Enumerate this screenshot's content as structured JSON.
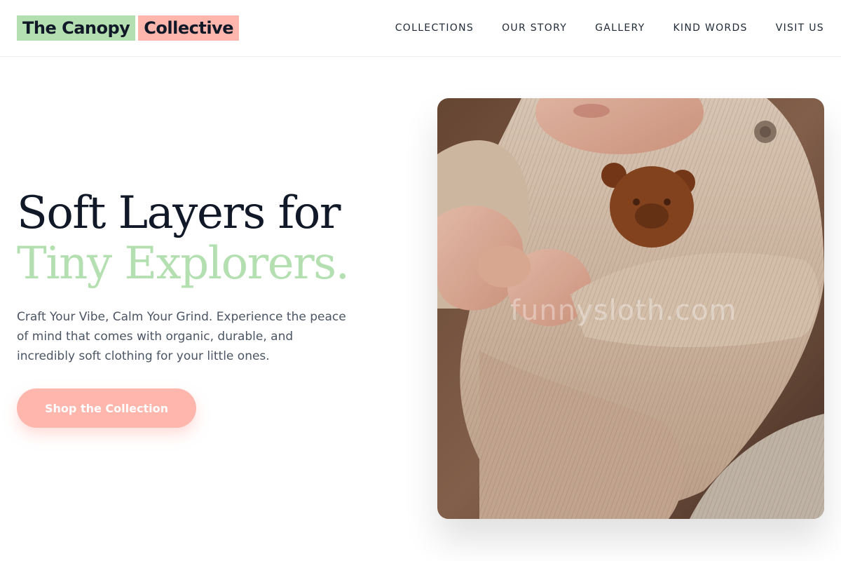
{
  "header": {
    "logo": {
      "part1": "The Canopy",
      "part2": "Collective"
    },
    "nav": [
      {
        "label": "COLLECTIONS"
      },
      {
        "label": "OUR STORY"
      },
      {
        "label": "GALLERY"
      },
      {
        "label": "KIND WORDS"
      },
      {
        "label": "VISIT US"
      }
    ]
  },
  "hero": {
    "title_line1": "Soft Layers for",
    "title_line2": "Tiny Explorers.",
    "description": "Craft Your Vibe, Calm Your Grind. Experience the peace of mind that comes with organic, durable, and incredibly soft clothing for your little ones.",
    "cta_label": "Shop the Collection",
    "image": {
      "alt": "Baby in cream knit sweater with brown bear patch",
      "watermark": "funnysloth.com"
    }
  },
  "colors": {
    "accent_green": "#b4e0b1",
    "accent_pink": "#ffb6ad",
    "text_dark": "#111827",
    "text_muted": "#4b5563"
  }
}
